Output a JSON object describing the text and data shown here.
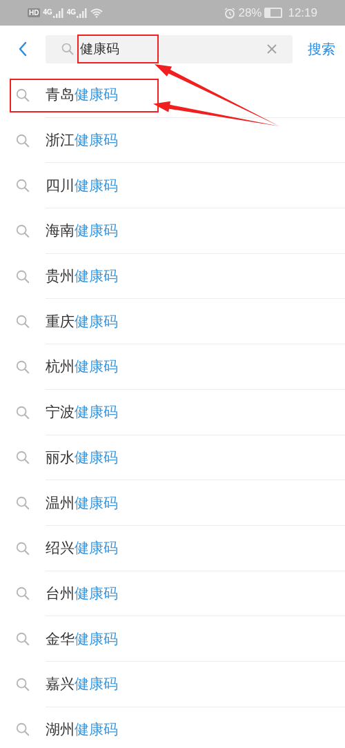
{
  "status_bar": {
    "hd": "HD",
    "networks": [
      "4G",
      "4G"
    ],
    "battery_percent": "28%",
    "time": "12:19"
  },
  "search_bar": {
    "value": "健康码",
    "highlighted": true,
    "action": "搜索"
  },
  "suggestions": [
    {
      "prefix": "青岛",
      "match": "健康码",
      "highlighted": true
    },
    {
      "prefix": "浙江",
      "match": "健康码",
      "highlighted": false
    },
    {
      "prefix": "四川",
      "match": "健康码",
      "highlighted": false
    },
    {
      "prefix": "海南",
      "match": "健康码",
      "highlighted": false
    },
    {
      "prefix": "贵州",
      "match": "健康码",
      "highlighted": false
    },
    {
      "prefix": "重庆",
      "match": "健康码",
      "highlighted": false
    },
    {
      "prefix": "杭州",
      "match": "健康码",
      "highlighted": false
    },
    {
      "prefix": "宁波",
      "match": "健康码",
      "highlighted": false
    },
    {
      "prefix": "丽水",
      "match": "健康码",
      "highlighted": false
    },
    {
      "prefix": "温州",
      "match": "健康码",
      "highlighted": false
    },
    {
      "prefix": "绍兴",
      "match": "健康码",
      "highlighted": false
    },
    {
      "prefix": "台州",
      "match": "健康码",
      "highlighted": false
    },
    {
      "prefix": "金华",
      "match": "健康码",
      "highlighted": false
    },
    {
      "prefix": "嘉兴",
      "match": "健康码",
      "highlighted": false
    },
    {
      "prefix": "湖州",
      "match": "健康码",
      "highlighted": false
    }
  ]
}
